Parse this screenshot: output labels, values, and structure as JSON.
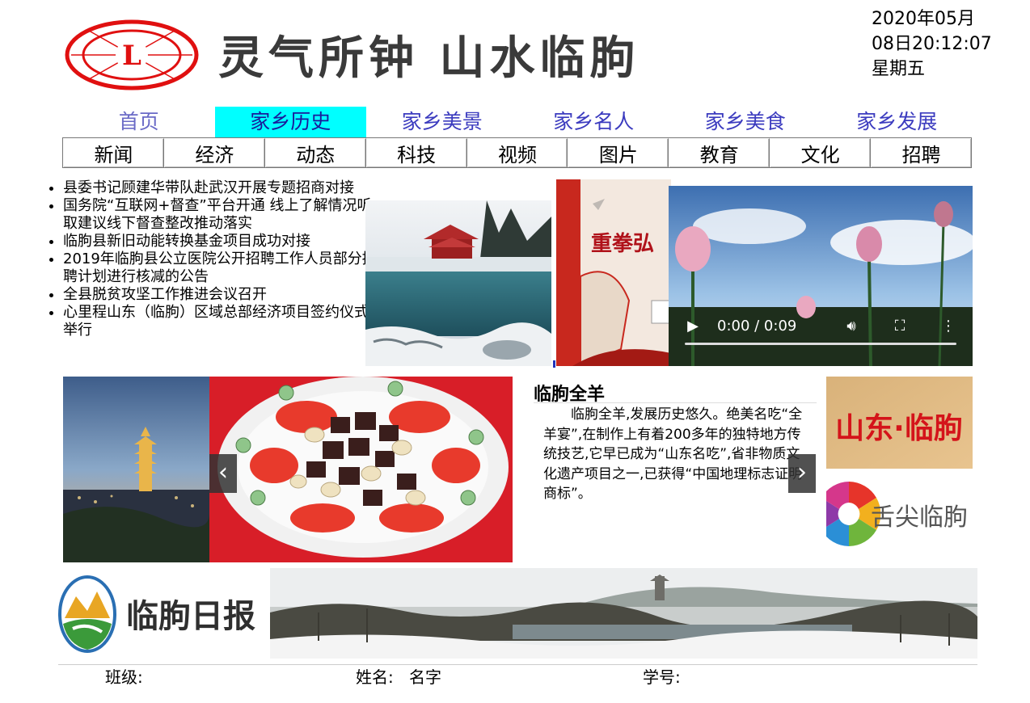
{
  "header": {
    "title": "灵气所钟 山水临朐",
    "logo_letter": "L",
    "datetime": "2020年05月08日20:12:07 星期五"
  },
  "topnav": [
    {
      "label": "首页",
      "active": false
    },
    {
      "label": "家乡历史",
      "active": true
    },
    {
      "label": "家乡美景",
      "active": false
    },
    {
      "label": "家乡名人",
      "active": false
    },
    {
      "label": "家乡美食",
      "active": false
    },
    {
      "label": "家乡发展",
      "active": false
    }
  ],
  "subnav": [
    "新闻",
    "经济",
    "动态",
    "科技",
    "视频",
    "图片",
    "教育",
    "文化",
    "招聘"
  ],
  "news": [
    "县委书记顾建华带队赴武汉开展专题招商对接",
    "国务院“互联网+督查”平台开通 线上了解情况听取建议线下督查整改推动落实",
    "临朐县新旧动能转换基金项目成功对接",
    "2019年临朐县公立医院公开招聘工作人员部分招聘计划进行核减的公告",
    "全县脱贫攻坚工作推进会议召开",
    "心里程山东（临朐）区域总部经济项目签约仪式举行"
  ],
  "poster": {
    "text": "重拳弘"
  },
  "video": {
    "time": "0:00 / 0:09",
    "progress": 0
  },
  "food": {
    "title": "临朐全羊",
    "text": "临朐全羊,发展历史悠久。绝美名吃“全羊宴”,在制作上有着200多年的独特地方传统技艺,它早已成为“山东名吃”,省非物质文化遗产项目之一,已获得“中国地理标志证明商标”。"
  },
  "carousel": {
    "prev": "‹",
    "next": "›"
  },
  "banners": {
    "shandong": "山东·临朐",
    "tongue": "舌尖临朐",
    "daily": "临朐日报"
  },
  "footer": {
    "class_label": "班级:",
    "name_label": "姓名:",
    "name_value": "名字",
    "id_label": "学号:"
  },
  "colors": {
    "nav_text": "#3b3bbf",
    "nav_active_bg": "#00ffff",
    "logo_red": "#e01010"
  }
}
